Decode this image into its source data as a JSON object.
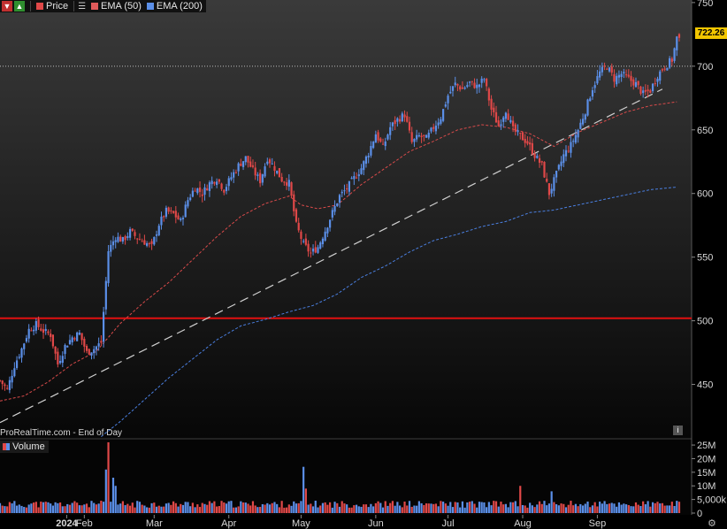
{
  "legend": {
    "items": [
      {
        "label": "Price",
        "color": "#e04848",
        "icon": "candle-swatch-icon"
      },
      {
        "label": "EMA (50)",
        "color": "#e05a5a",
        "icon": "line-swatch-icon"
      },
      {
        "label": "EMA (200)",
        "color": "#5b8fe8",
        "icon": "line-swatch-icon"
      }
    ],
    "buttons": [
      "down-arrow-icon",
      "up-arrow-icon",
      "menu-icon"
    ]
  },
  "volume_legend": {
    "label": "Volume",
    "color": "#5b8fe8",
    "icon": "volume-swatch-icon"
  },
  "last_price": "722.26",
  "source": "ProRealTime.com - End of Day",
  "info_icon_label": "i",
  "colors": {
    "up": "#5b8fe8",
    "down": "#e04848",
    "ema50": "#d94a4a",
    "ema200": "#4a7fe0",
    "support": "#e01010",
    "trend": "#d0d0d0",
    "dotted": "#bdbdbd",
    "last": "#f2c600"
  },
  "chart_data": {
    "type": "candlestick",
    "y_ticks": [
      "750",
      "700",
      "650",
      "600",
      "550",
      "500",
      "450"
    ],
    "y_tick_values": [
      750,
      700,
      650,
      600,
      550,
      500,
      450
    ],
    "ylim": [
      408,
      752
    ],
    "x_ticks": [
      "2024",
      "Feb",
      "Mar",
      "Apr",
      "May",
      "Jun",
      "Jul",
      "Aug",
      "Sep"
    ],
    "x_tick_days": [
      2,
      35,
      64,
      95,
      125,
      156,
      186,
      217,
      248
    ],
    "xlim": [
      0,
      282
    ],
    "price_anchors_day_close": [
      [
        0,
        453
      ],
      [
        3,
        446
      ],
      [
        6,
        465
      ],
      [
        9,
        478
      ],
      [
        12,
        493
      ],
      [
        15,
        497
      ],
      [
        18,
        492
      ],
      [
        21,
        489
      ],
      [
        24,
        466
      ],
      [
        27,
        480
      ],
      [
        30,
        487
      ],
      [
        33,
        490
      ],
      [
        36,
        475
      ],
      [
        39,
        478
      ],
      [
        42,
        483
      ],
      [
        45,
        555
      ],
      [
        48,
        566
      ],
      [
        51,
        563
      ],
      [
        54,
        570
      ],
      [
        57,
        565
      ],
      [
        60,
        562
      ],
      [
        63,
        558
      ],
      [
        66,
        576
      ],
      [
        69,
        586
      ],
      [
        72,
        584
      ],
      [
        75,
        578
      ],
      [
        78,
        595
      ],
      [
        81,
        605
      ],
      [
        84,
        600
      ],
      [
        87,
        608
      ],
      [
        90,
        612
      ],
      [
        93,
        603
      ],
      [
        96,
        613
      ],
      [
        99,
        622
      ],
      [
        102,
        628
      ],
      [
        105,
        618
      ],
      [
        108,
        610
      ],
      [
        111,
        628
      ],
      [
        114,
        620
      ],
      [
        117,
        611
      ],
      [
        120,
        608
      ],
      [
        123,
        575
      ],
      [
        126,
        560
      ],
      [
        129,
        553
      ],
      [
        132,
        558
      ],
      [
        135,
        571
      ],
      [
        138,
        585
      ],
      [
        141,
        598
      ],
      [
        144,
        604
      ],
      [
        147,
        612
      ],
      [
        150,
        620
      ],
      [
        153,
        632
      ],
      [
        156,
        647
      ],
      [
        159,
        636
      ],
      [
        162,
        652
      ],
      [
        165,
        658
      ],
      [
        168,
        662
      ],
      [
        171,
        640
      ],
      [
        174,
        645
      ],
      [
        177,
        643
      ],
      [
        180,
        652
      ],
      [
        183,
        660
      ],
      [
        186,
        677
      ],
      [
        189,
        686
      ],
      [
        192,
        682
      ],
      [
        195,
        687
      ],
      [
        198,
        684
      ],
      [
        201,
        690
      ],
      [
        204,
        666
      ],
      [
        207,
        653
      ],
      [
        210,
        666
      ],
      [
        213,
        650
      ],
      [
        216,
        645
      ],
      [
        219,
        640
      ],
      [
        222,
        630
      ],
      [
        225,
        622
      ],
      [
        228,
        600
      ],
      [
        231,
        615
      ],
      [
        234,
        630
      ],
      [
        237,
        638
      ],
      [
        240,
        650
      ],
      [
        243,
        665
      ],
      [
        246,
        683
      ],
      [
        249,
        695
      ],
      [
        252,
        700
      ],
      [
        255,
        690
      ],
      [
        258,
        694
      ],
      [
        261,
        690
      ],
      [
        264,
        686
      ],
      [
        267,
        678
      ],
      [
        270,
        681
      ],
      [
        273,
        693
      ],
      [
        276,
        700
      ],
      [
        279,
        705
      ],
      [
        281,
        722
      ]
    ],
    "ema50_anchors_day_value": [
      [
        0,
        437
      ],
      [
        10,
        441
      ],
      [
        20,
        452
      ],
      [
        30,
        466
      ],
      [
        40,
        476
      ],
      [
        50,
        498
      ],
      [
        60,
        515
      ],
      [
        70,
        530
      ],
      [
        80,
        548
      ],
      [
        90,
        566
      ],
      [
        100,
        582
      ],
      [
        110,
        592
      ],
      [
        120,
        598
      ],
      [
        125,
        591
      ],
      [
        132,
        588
      ],
      [
        140,
        591
      ],
      [
        150,
        607
      ],
      [
        160,
        620
      ],
      [
        170,
        633
      ],
      [
        180,
        641
      ],
      [
        190,
        650
      ],
      [
        200,
        654
      ],
      [
        210,
        652
      ],
      [
        220,
        647
      ],
      [
        230,
        637
      ],
      [
        240,
        648
      ],
      [
        250,
        656
      ],
      [
        260,
        664
      ],
      [
        270,
        669
      ],
      [
        281,
        672
      ]
    ],
    "ema200_anchors_day_value": [
      [
        42,
        409
      ],
      [
        50,
        421
      ],
      [
        60,
        438
      ],
      [
        70,
        455
      ],
      [
        80,
        470
      ],
      [
        90,
        485
      ],
      [
        100,
        496
      ],
      [
        110,
        501
      ],
      [
        120,
        507
      ],
      [
        130,
        512
      ],
      [
        140,
        521
      ],
      [
        150,
        534
      ],
      [
        160,
        543
      ],
      [
        170,
        554
      ],
      [
        180,
        563
      ],
      [
        190,
        568
      ],
      [
        200,
        574
      ],
      [
        210,
        578
      ],
      [
        220,
        585
      ],
      [
        230,
        587
      ],
      [
        240,
        591
      ],
      [
        250,
        595
      ],
      [
        260,
        599
      ],
      [
        270,
        603
      ],
      [
        281,
        605
      ]
    ],
    "support_level": 502,
    "trendline": [
      [
        0,
        420
      ],
      [
        275,
        682
      ]
    ],
    "last_close": 722.26,
    "volume": {
      "y_ticks": [
        "25M",
        "20M",
        "15M",
        "10M",
        "5,000k",
        "0"
      ],
      "y_tick_values": [
        25,
        20,
        15,
        10,
        5,
        0
      ],
      "ylim": [
        0,
        26
      ],
      "spikes_day_millions": [
        [
          44,
          16
        ],
        [
          45,
          26
        ],
        [
          47,
          13
        ],
        [
          48,
          10
        ],
        [
          126,
          17
        ],
        [
          127,
          9
        ],
        [
          216,
          10
        ],
        [
          229,
          8
        ]
      ],
      "base_millions": 3
    }
  }
}
